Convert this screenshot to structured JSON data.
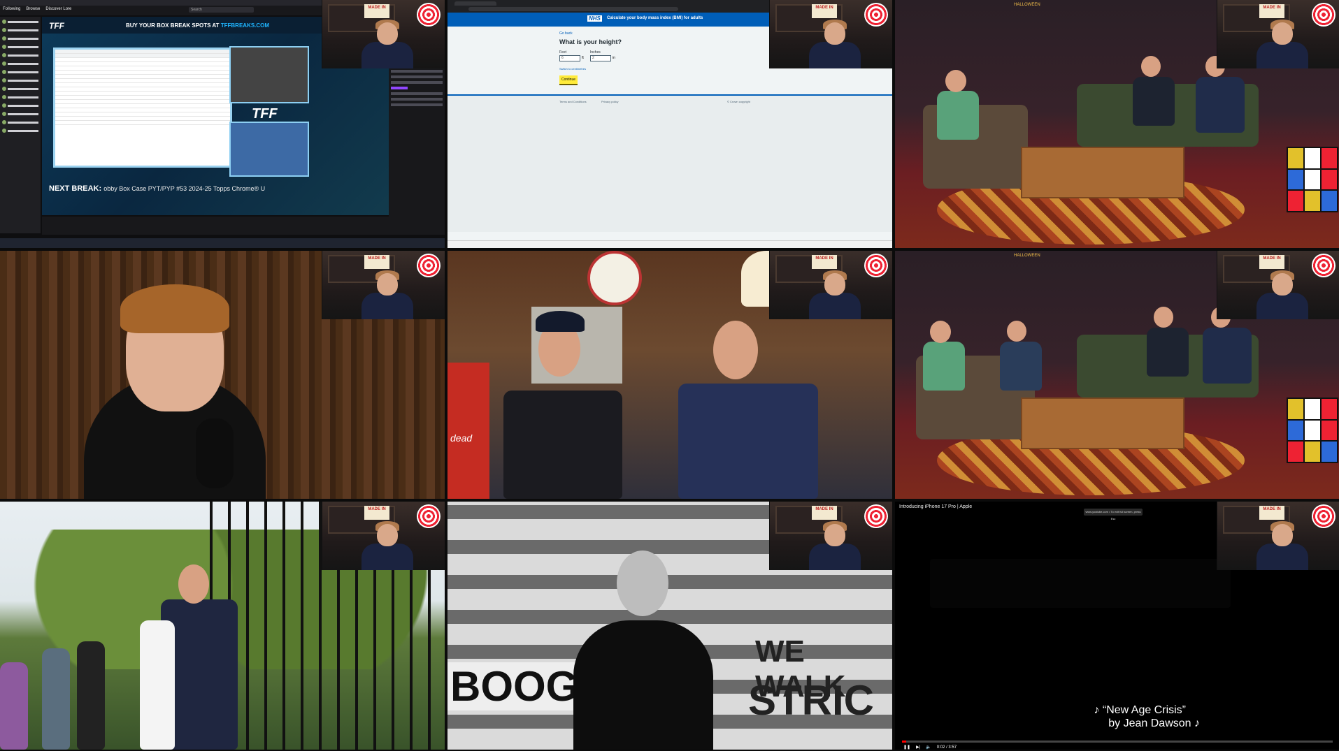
{
  "cell1": {
    "nav": [
      "Following",
      "Browse",
      "Discover Lore"
    ],
    "search_placeholder": "Search",
    "banner": "BUY YOUR BOX BREAK SPOTS AT",
    "banner_site": "TFFBREAKS.COM",
    "logo": "TFF",
    "next_label": "NEXT BREAK:",
    "next_text": "obby Box Case PYT/PYP #53 2024-25 Topps Chrome® U"
  },
  "cell2": {
    "logo": "NHS",
    "title": "Calculate your body mass index (BMI) for adults",
    "back": "Go back",
    "question": "What is your height?",
    "feet_label": "Feet",
    "feet_value": "6",
    "feet_unit": "ft",
    "inches_label": "Inches",
    "inches_value": "2",
    "inches_unit": "in",
    "switch": "Switch to centimetres",
    "button": "Continue",
    "footer": [
      "Terms and Conditions",
      "Privacy policy",
      "© Crown copyright"
    ]
  },
  "cell3": {
    "label": "HALLOWEEN"
  },
  "cell5": {
    "wall_text": "dead"
  },
  "cell8": {
    "wall_text_1": "BOOG",
    "wall_text_2": "WE WALK",
    "wall_text_3": "STRIC"
  },
  "cell9": {
    "title": "Introducing iPhone 17 Pro | Apple",
    "banner": "www.youtube.com • To exit full screen, press Esc",
    "lyric_line1": "♪ “New Age Crisis”",
    "lyric_line2": "by Jean Dawson ♪",
    "time": "0:02 / 3:57",
    "progress": 0.01
  },
  "webcam": {
    "sign": "MADE IN"
  },
  "colors": {
    "twitch_purple": "#9147ff",
    "nhs_blue": "#005eb8",
    "yt_red": "#ff0000"
  }
}
